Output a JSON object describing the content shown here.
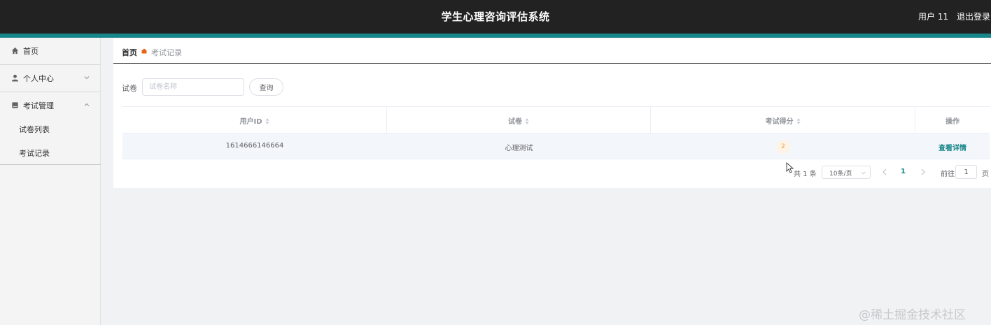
{
  "header": {
    "title": "学生心理咨询评估系统",
    "user": "用户 11",
    "logout": "退出登录",
    "accent_color": "#16868a"
  },
  "sidebar": {
    "items": [
      {
        "label": "首页",
        "icon": "home-icon"
      },
      {
        "label": "个人中心",
        "icon": "user-icon",
        "expanded": false
      },
      {
        "label": "考试管理",
        "icon": "exam-icon",
        "expanded": true,
        "children": [
          {
            "label": "试卷列表"
          },
          {
            "label": "考试记录"
          }
        ]
      }
    ]
  },
  "breadcrumb": {
    "home": "首页",
    "current": "考试记录"
  },
  "search": {
    "label": "试卷",
    "placeholder": "试卷名称",
    "button": "查询"
  },
  "table": {
    "columns": [
      {
        "label": "用户ID",
        "sortable": true
      },
      {
        "label": "试卷",
        "sortable": true
      },
      {
        "label": "考试得分",
        "sortable": true
      },
      {
        "label": "操作",
        "sortable": false
      }
    ],
    "rows": [
      {
        "user_id": "1614666146664",
        "paper": "心理测试",
        "score": "2",
        "action": "查看详情"
      }
    ]
  },
  "pagination": {
    "total": "共 1 条",
    "page_size": "10条/页",
    "current_page": "1",
    "goto_label": "前往",
    "goto_value": "1",
    "page_suffix": "页"
  },
  "watermark": "@稀土掘金技术社区"
}
